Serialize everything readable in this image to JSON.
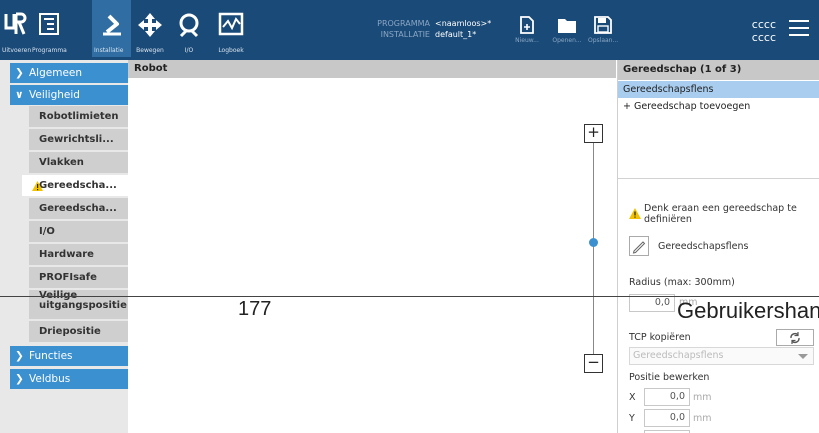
{
  "topbar": {
    "buttons": [
      {
        "label": "Uitvoeren",
        "icon": "ur-logo-icon"
      },
      {
        "label": "Programma",
        "icon": "program-tree-icon"
      },
      {
        "label": "Installatie",
        "icon": "installation-robot-icon"
      },
      {
        "label": "Bewegen",
        "icon": "move-arrows-icon"
      },
      {
        "label": "I/O",
        "icon": "io-icon"
      },
      {
        "label": "Logboek",
        "icon": "log-chart-icon"
      }
    ],
    "program_key": "PROGRAMMA",
    "program_value": "<naamloos>*",
    "installation_key": "INSTALLATIE",
    "installation_value": "default_1*",
    "file_buttons": [
      {
        "label": "Nieuw...",
        "icon": "new-file-icon"
      },
      {
        "label": "Openen...",
        "icon": "folder-icon"
      },
      {
        "label": "Opslaan...",
        "icon": "save-icon"
      }
    ],
    "right_line1": "cccc",
    "right_line2": "cccc"
  },
  "sidebar": {
    "sections": [
      {
        "label": "Algemeen"
      },
      {
        "label": "Veiligheid"
      },
      {
        "label": "Functies"
      },
      {
        "label": "Veldbus"
      }
    ],
    "items": [
      {
        "label": "Robotlimieten"
      },
      {
        "label": "Gewrichtsli..."
      },
      {
        "label": "Vlakken"
      },
      {
        "label": "Gereedscha..."
      },
      {
        "label": "Gereedscha..."
      },
      {
        "label": "I/O"
      },
      {
        "label": "Hardware"
      },
      {
        "label": "PROFIsafe"
      },
      {
        "label": "Veilige uitgangspositie"
      },
      {
        "label": "Driepositie"
      }
    ]
  },
  "robot_panel": {
    "title": "Robot",
    "zoom_in": "+",
    "zoom_out": "−"
  },
  "tool_panel": {
    "title": "Gereedschap (1 of 3)",
    "items": [
      "Gereedschapsflens"
    ],
    "add_label": "+ Gereedschap toevoegen",
    "warning_text": "Denk eraan een gereedschap te definiëren",
    "tool_name": "Gereedschapsflens",
    "radius_label": "Radius (max: 300mm)",
    "radius_value": "0,0",
    "radius_unit": "mm",
    "tcp_copy_label": "TCP kopiëren",
    "tcp_select_value": "Gereedschapsflens",
    "edit_position_label": "Positie bewerken",
    "x_label": "X",
    "x_value": "0,0",
    "y_label": "Y",
    "y_value": "0,0",
    "unit": "mm"
  },
  "overlay": {
    "page_number": "177",
    "page_title": "Gebruikershan"
  },
  "colors": {
    "topbar": "#1a4a78",
    "active_tab": "#2f6da3",
    "accent_blue": "#3b90d0",
    "selection": "#a9cdee",
    "warning": "#f2c200"
  }
}
